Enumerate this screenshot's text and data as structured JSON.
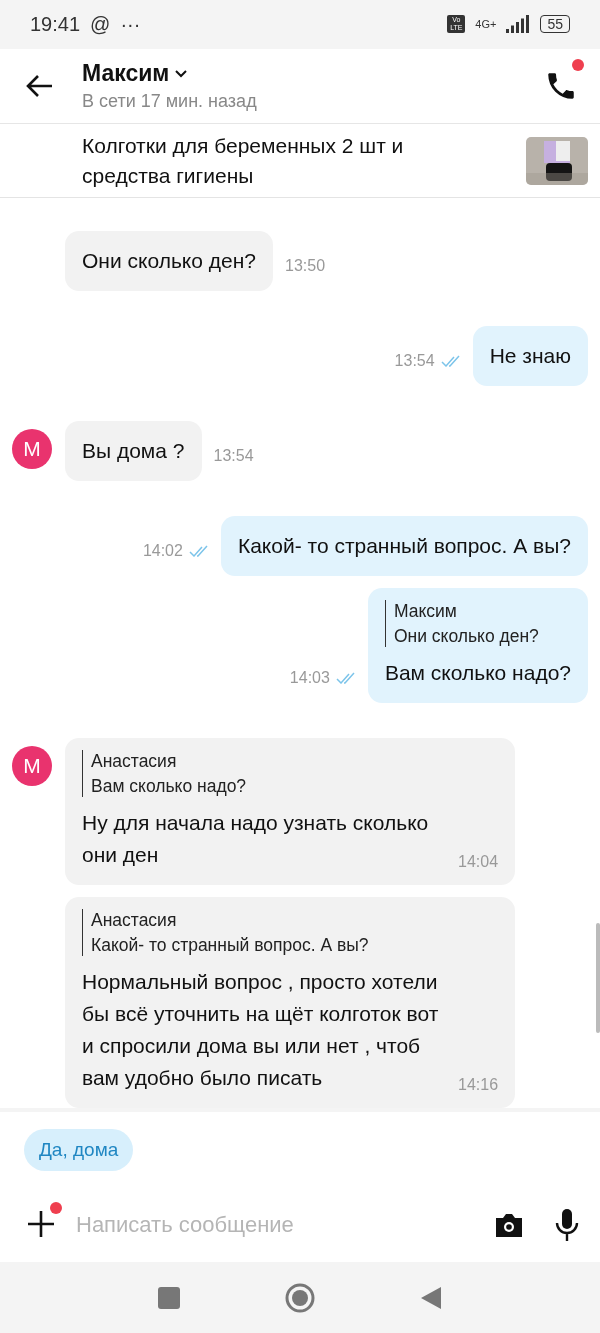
{
  "status_bar": {
    "time": "19:41",
    "at_sign": "@",
    "more": "···",
    "network": "4G+",
    "volte": "Vo LTE",
    "battery": "55"
  },
  "header": {
    "name": "Максим",
    "status": "В сети 17 мин. назад",
    "call_badge": true
  },
  "product": {
    "title": "Колготки для беременных 2 шт и средства гигиены"
  },
  "messages": [
    {
      "kind": "in",
      "text": "Они сколько ден?",
      "time": "13:50"
    },
    {
      "kind": "out",
      "text": "Не знаю",
      "time": "13:54",
      "read": true
    },
    {
      "kind": "in",
      "avatar": "М",
      "text": "Вы дома ?",
      "time": "13:54"
    },
    {
      "kind": "out",
      "text": "Какой- то странный вопрос. А вы?",
      "time": "14:02",
      "read": true
    },
    {
      "kind": "out",
      "quote": {
        "author": "Максим",
        "text": "Они сколько ден?"
      },
      "text": "Вам сколько надо?",
      "time": "14:03",
      "read": true
    },
    {
      "kind": "in",
      "avatar": "М",
      "quote": {
        "author": "Анастасия",
        "text": "Вам сколько надо?"
      },
      "text": "Ну для начала надо узнать сколько они ден",
      "time": "14:04"
    },
    {
      "kind": "in",
      "quote": {
        "author": "Анастасия",
        "text": "Какой- то странный вопрос. А вы?"
      },
      "text": "Нормальный вопрос , просто хотели бы всё уточнить на щёт колготок вот и спросили дома вы или нет , чтоб вам удобно было писать",
      "time": "14:16"
    }
  ],
  "quick_replies": [
    "Да, дома"
  ],
  "composer": {
    "placeholder": "Написать сообщение",
    "attach_badge": true
  }
}
